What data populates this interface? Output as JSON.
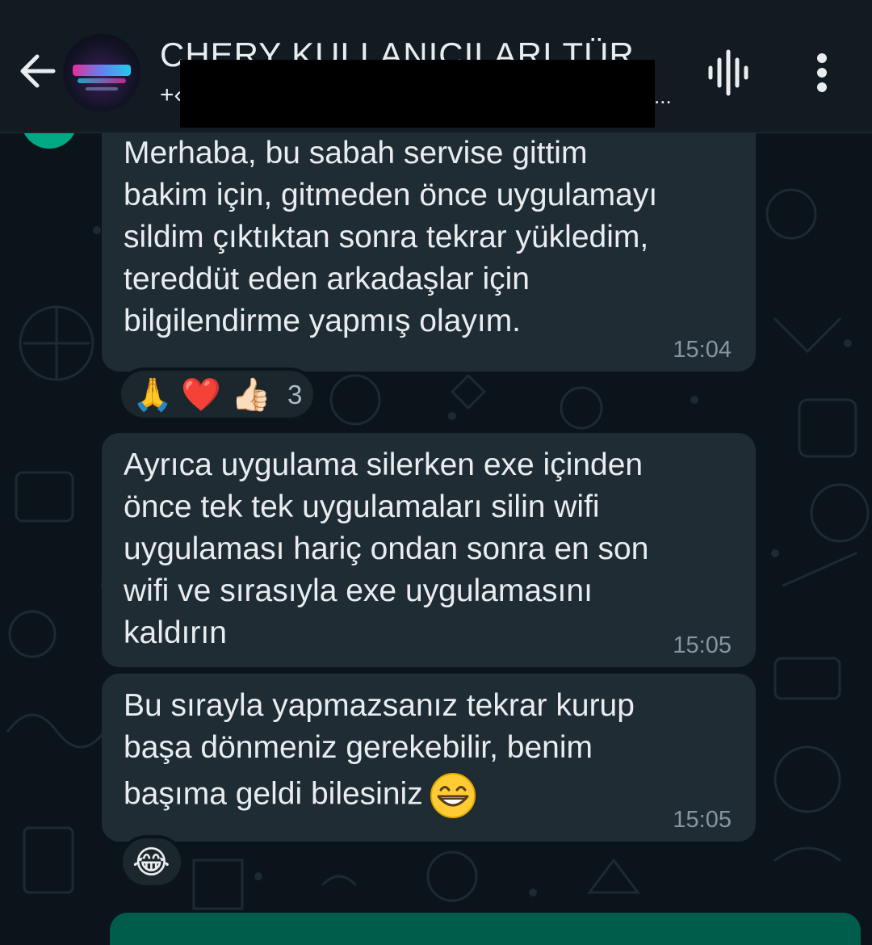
{
  "header": {
    "chat_title": "CHERY KULLANICILARI TÜR",
    "subtitle_prefix": "+‹",
    "subtitle_ellipsis": "..."
  },
  "messages": [
    {
      "text": "Merhaba, bu sabah servise gittim\nbakim için, gitmeden önce uygulamayı\nsildim çıktıktan sonra tekrar yükledim,\ntereddüt eden arkadaşlar için\nbilgilendirme yapmış olayım.",
      "time": "15:04",
      "reactions": {
        "emojis": [
          "🙏",
          "❤️",
          "👍🏻"
        ],
        "count": "3"
      }
    },
    {
      "text": "Ayrıca uygulama silerken exe içinden\nönce tek tek uygulamaları silin wifi\nuygulaması hariç ondan sonra en son\nwifi ve sırasıyla exe uygulamasını\nkaldırın",
      "time": "15:05"
    },
    {
      "text_line1": "Bu sırayla yapmazsanız tekrar kurup",
      "text_line2": "başa dönmeniz gerekebilir, benim",
      "text_line3": "başıma geldi bilesiniz",
      "inline_emoji": "grinning-face-with-smiling-eyes",
      "time": "15:05",
      "reactions": {
        "emojis": [
          "😂"
        ]
      }
    }
  ],
  "icons": {
    "back": "arrow-left-icon",
    "voice": "audio-wave-icon",
    "menu": "more-vertical-icon"
  },
  "colors": {
    "header_bg": "#111b21",
    "chat_bg": "#0b141a",
    "bubble_bg": "#202c33",
    "timestamp": "#8696a0",
    "accent_green": "#00a884"
  }
}
